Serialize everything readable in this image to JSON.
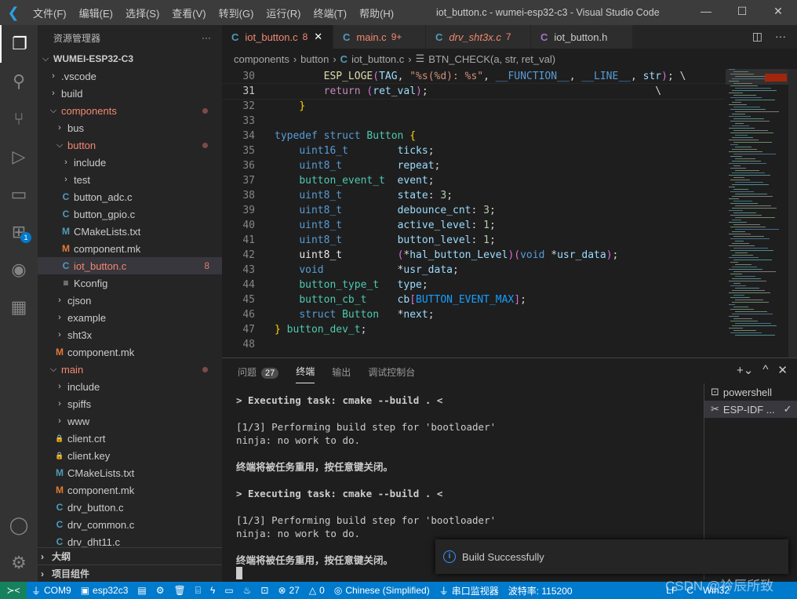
{
  "titlebar": {
    "menus": [
      "文件(F)",
      "编辑(E)",
      "选择(S)",
      "查看(V)",
      "转到(G)",
      "运行(R)",
      "终端(T)",
      "帮助(H)"
    ],
    "title": "iot_button.c - wumei-esp32-c3 - Visual Studio Code"
  },
  "activity": {
    "icons": [
      "explorer-icon",
      "search-icon",
      "source-control-icon",
      "run-debug-icon",
      "remote-explorer-icon",
      "extensions-icon",
      "espressif-icon",
      "esp-idf-icon"
    ],
    "extensions_badge": "1"
  },
  "sidebar": {
    "title": "资源管理器",
    "more": "···",
    "items": [
      {
        "label": "WUMEI-ESP32-C3",
        "level": 0,
        "type": "folder",
        "open": true,
        "root": true
      },
      {
        "label": ".vscode",
        "level": 1,
        "type": "folder"
      },
      {
        "label": "build",
        "level": 1,
        "type": "folder"
      },
      {
        "label": "components",
        "level": 1,
        "type": "folder",
        "open": true,
        "modified": true
      },
      {
        "label": "bus",
        "level": 2,
        "type": "folder"
      },
      {
        "label": "button",
        "level": 2,
        "type": "folder",
        "open": true,
        "modified": true
      },
      {
        "label": "include",
        "level": 3,
        "type": "folder"
      },
      {
        "label": "test",
        "level": 3,
        "type": "folder"
      },
      {
        "label": "button_adc.c",
        "level": 3,
        "type": "c"
      },
      {
        "label": "button_gpio.c",
        "level": 3,
        "type": "c"
      },
      {
        "label": "CMakeLists.txt",
        "level": 3,
        "type": "cmake"
      },
      {
        "label": "component.mk",
        "level": 3,
        "type": "mk"
      },
      {
        "label": "iot_button.c",
        "level": 3,
        "type": "c",
        "selected": true,
        "errors": "8"
      },
      {
        "label": "Kconfig",
        "level": 3,
        "type": "text"
      },
      {
        "label": "cjson",
        "level": 2,
        "type": "folder"
      },
      {
        "label": "example",
        "level": 2,
        "type": "folder"
      },
      {
        "label": "sht3x",
        "level": 2,
        "type": "folder"
      },
      {
        "label": "component.mk",
        "level": 2,
        "type": "mk"
      },
      {
        "label": "main",
        "level": 1,
        "type": "folder",
        "open": true,
        "modified": true
      },
      {
        "label": "include",
        "level": 2,
        "type": "folder"
      },
      {
        "label": "spiffs",
        "level": 2,
        "type": "folder"
      },
      {
        "label": "www",
        "level": 2,
        "type": "folder"
      },
      {
        "label": "client.crt",
        "level": 2,
        "type": "lock"
      },
      {
        "label": "client.key",
        "level": 2,
        "type": "lock"
      },
      {
        "label": "CMakeLists.txt",
        "level": 2,
        "type": "cmake"
      },
      {
        "label": "component.mk",
        "level": 2,
        "type": "mk"
      },
      {
        "label": "drv_button.c",
        "level": 2,
        "type": "c"
      },
      {
        "label": "drv_common.c",
        "level": 2,
        "type": "c"
      },
      {
        "label": "drv_dht11.c",
        "level": 2,
        "type": "c"
      }
    ],
    "outline": "大纲",
    "project_components": "项目组件"
  },
  "tabs": [
    {
      "label": "iot_button.c",
      "count": "8",
      "icon": "C",
      "active": true,
      "color": "#f48771"
    },
    {
      "label": "main.c",
      "count": "9+",
      "icon": "C",
      "color": "#f48771"
    },
    {
      "label": "drv_sht3x.c",
      "count": "7",
      "icon": "C",
      "italic": true,
      "color": "#f48771"
    },
    {
      "label": "iot_button.h",
      "count": "",
      "icon": "C",
      "header": true,
      "color": "#cccccc"
    }
  ],
  "breadcrumb": [
    "components",
    "button",
    "iot_button.c",
    "BTN_CHECK(a, str, ret_val)"
  ],
  "editor": {
    "current_line": 31,
    "lines": [
      {
        "n": "30",
        "t": [
          [
            "        ",
            "pl"
          ],
          [
            "ESP_LOGE",
            "fn"
          ],
          [
            "(",
            "br2"
          ],
          [
            "TAG",
            "id"
          ],
          [
            ", ",
            "pl"
          ],
          [
            "\"%s(%d): %s\"",
            "str"
          ],
          [
            ", ",
            "pl"
          ],
          [
            "__FUNCTION__",
            "mac"
          ],
          [
            ", ",
            "pl"
          ],
          [
            "__LINE__",
            "mac"
          ],
          [
            ", ",
            "pl"
          ],
          [
            "str",
            "id"
          ],
          [
            ")",
            "br2"
          ],
          [
            "; \\",
            "pl"
          ]
        ]
      },
      {
        "n": "31",
        "t": [
          [
            "        ",
            "pl"
          ],
          [
            "return",
            "ctl"
          ],
          [
            " ",
            "pl"
          ],
          [
            "(",
            "br2"
          ],
          [
            "ret_val",
            "id"
          ],
          [
            ")",
            "br2"
          ],
          [
            ";",
            "pl"
          ],
          [
            "                                     \\",
            "pl"
          ]
        ]
      },
      {
        "n": "32",
        "t": [
          [
            "    ",
            "pl"
          ],
          [
            "}",
            "br1"
          ]
        ]
      },
      {
        "n": "33",
        "t": []
      },
      {
        "n": "34",
        "t": [
          [
            "typedef",
            "kw"
          ],
          [
            " ",
            "pl"
          ],
          [
            "struct",
            "kw"
          ],
          [
            " ",
            "pl"
          ],
          [
            "Button",
            "ty"
          ],
          [
            " ",
            "pl"
          ],
          [
            "{",
            "br1"
          ]
        ]
      },
      {
        "n": "35",
        "t": [
          [
            "    ",
            "pl"
          ],
          [
            "uint16_t",
            "kw"
          ],
          [
            "        ",
            "pl"
          ],
          [
            "ticks",
            "id"
          ],
          [
            ";",
            "pl"
          ]
        ]
      },
      {
        "n": "36",
        "t": [
          [
            "    ",
            "pl"
          ],
          [
            "uint8_t",
            "kw"
          ],
          [
            "         ",
            "pl"
          ],
          [
            "repeat",
            "id"
          ],
          [
            ";",
            "pl"
          ]
        ]
      },
      {
        "n": "37",
        "t": [
          [
            "    ",
            "pl"
          ],
          [
            "button_event_t",
            "ty"
          ],
          [
            "  ",
            "pl"
          ],
          [
            "event",
            "id"
          ],
          [
            ";",
            "pl"
          ]
        ]
      },
      {
        "n": "38",
        "t": [
          [
            "    ",
            "pl"
          ],
          [
            "uint8_t",
            "kw"
          ],
          [
            "         ",
            "pl"
          ],
          [
            "state",
            "id"
          ],
          [
            ": ",
            "pl"
          ],
          [
            "3",
            "num"
          ],
          [
            ";",
            "pl"
          ]
        ]
      },
      {
        "n": "39",
        "t": [
          [
            "    ",
            "pl"
          ],
          [
            "uint8_t",
            "kw"
          ],
          [
            "         ",
            "pl"
          ],
          [
            "debounce_cnt",
            "id"
          ],
          [
            ": ",
            "pl"
          ],
          [
            "3",
            "num"
          ],
          [
            ";",
            "pl"
          ]
        ]
      },
      {
        "n": "40",
        "t": [
          [
            "    ",
            "pl"
          ],
          [
            "uint8_t",
            "kw"
          ],
          [
            "         ",
            "pl"
          ],
          [
            "active_level",
            "id"
          ],
          [
            ": ",
            "pl"
          ],
          [
            "1",
            "num"
          ],
          [
            ";",
            "pl"
          ]
        ]
      },
      {
        "n": "41",
        "t": [
          [
            "    ",
            "pl"
          ],
          [
            "uint8_t",
            "kw"
          ],
          [
            "         ",
            "pl"
          ],
          [
            "button_level",
            "id"
          ],
          [
            ": ",
            "pl"
          ],
          [
            "1",
            "num"
          ],
          [
            ";",
            "pl"
          ]
        ]
      },
      {
        "n": "42",
        "t": [
          [
            "    ",
            "pl"
          ],
          [
            "uint8_t",
            "wh"
          ],
          [
            "         ",
            "pl"
          ],
          [
            "(",
            "br2"
          ],
          [
            "*",
            "pl"
          ],
          [
            "hal_button_Level",
            "id"
          ],
          [
            ")",
            "br2"
          ],
          [
            "(",
            "br2"
          ],
          [
            "void",
            "kw"
          ],
          [
            " *",
            "pl"
          ],
          [
            "usr_data",
            "id"
          ],
          [
            ")",
            "br2"
          ],
          [
            ";",
            "pl"
          ]
        ]
      },
      {
        "n": "43",
        "t": [
          [
            "    ",
            "pl"
          ],
          [
            "void",
            "kw"
          ],
          [
            "            ",
            "pl"
          ],
          [
            "*",
            "pl"
          ],
          [
            "usr_data",
            "id"
          ],
          [
            ";",
            "pl"
          ]
        ]
      },
      {
        "n": "44",
        "t": [
          [
            "    ",
            "pl"
          ],
          [
            "button_type_t",
            "ty"
          ],
          [
            "   ",
            "pl"
          ],
          [
            "type",
            "id"
          ],
          [
            ";",
            "pl"
          ]
        ]
      },
      {
        "n": "45",
        "t": [
          [
            "    ",
            "pl"
          ],
          [
            "button_cb_t",
            "ty"
          ],
          [
            "     ",
            "pl"
          ],
          [
            "cb",
            "id"
          ],
          [
            "[",
            "br2"
          ],
          [
            "BUTTON_EVENT_MAX",
            "br3"
          ],
          [
            "]",
            "br2"
          ],
          [
            ";",
            "pl"
          ]
        ]
      },
      {
        "n": "46",
        "t": [
          [
            "    ",
            "pl"
          ],
          [
            "struct",
            "kw"
          ],
          [
            " ",
            "pl"
          ],
          [
            "Button",
            "ty"
          ],
          [
            "   ",
            "pl"
          ],
          [
            "*",
            "pl"
          ],
          [
            "next",
            "id"
          ],
          [
            ";",
            "pl"
          ]
        ]
      },
      {
        "n": "47",
        "t": [
          [
            "}",
            "br1"
          ],
          [
            " ",
            "pl"
          ],
          [
            "button_dev_t",
            "ty"
          ],
          [
            ";",
            "pl"
          ]
        ]
      },
      {
        "n": "48",
        "t": []
      }
    ]
  },
  "panel": {
    "tabs": [
      {
        "label": "问题",
        "count": "27"
      },
      {
        "label": "终端",
        "active": true
      },
      {
        "label": "输出"
      },
      {
        "label": "调试控制台"
      }
    ],
    "terminal_lines": [
      {
        "text": "> Executing task: cmake --build . <",
        "bold": true
      },
      {
        "text": ""
      },
      {
        "text": "[1/3] Performing build step for 'bootloader'"
      },
      {
        "text": "ninja: no work to do."
      },
      {
        "text": ""
      },
      {
        "text": "终端将被任务重用，按任意键关闭。",
        "bold": true
      },
      {
        "text": ""
      },
      {
        "text": "> Executing task: cmake --build . <",
        "bold": true
      },
      {
        "text": ""
      },
      {
        "text": "[1/3] Performing build step for 'bootloader'"
      },
      {
        "text": "ninja: no work to do."
      },
      {
        "text": ""
      },
      {
        "text": "终端将被任务重用，按任意键关闭。",
        "bold": true
      }
    ],
    "terminals": [
      {
        "label": "powershell",
        "icon": "terminal-icon"
      },
      {
        "label": "ESP-IDF ...",
        "icon": "tools-icon",
        "active": true,
        "check": "✓"
      }
    ]
  },
  "notification": {
    "text": "Build Successfully"
  },
  "statusbar": {
    "items": [
      {
        "label": "COM9",
        "icon": "plug-icon"
      },
      {
        "label": "esp32c3",
        "icon": "chip-icon"
      },
      {
        "label": "",
        "icon": "folder-icon"
      },
      {
        "label": "",
        "icon": "gear-icon"
      },
      {
        "label": "",
        "icon": "trash-icon"
      },
      {
        "label": "",
        "icon": "database-icon"
      },
      {
        "label": "",
        "icon": "flash-icon"
      },
      {
        "label": "",
        "icon": "monitor-icon"
      },
      {
        "label": "",
        "icon": "flame-icon"
      },
      {
        "label": "",
        "icon": "terminal-icon"
      },
      {
        "label": "27",
        "icon": "error-icon"
      },
      {
        "label": "0",
        "icon": "warning-icon"
      },
      {
        "label": "Chinese (Simplified)",
        "icon": "broadcast-icon"
      },
      {
        "label": "串口监视器",
        "icon": "plug-icon"
      },
      {
        "label": "波特率: 115200",
        "icon": ""
      },
      {
        "label": "LF",
        "icon": ""
      },
      {
        "label": "C",
        "icon": ""
      },
      {
        "label": "Win32",
        "icon": ""
      }
    ],
    "watermark": "CSDN @衿辰所致"
  },
  "colors": {
    "accent": "#007acc",
    "remote": "#16825d",
    "error_text": "#f48771"
  }
}
